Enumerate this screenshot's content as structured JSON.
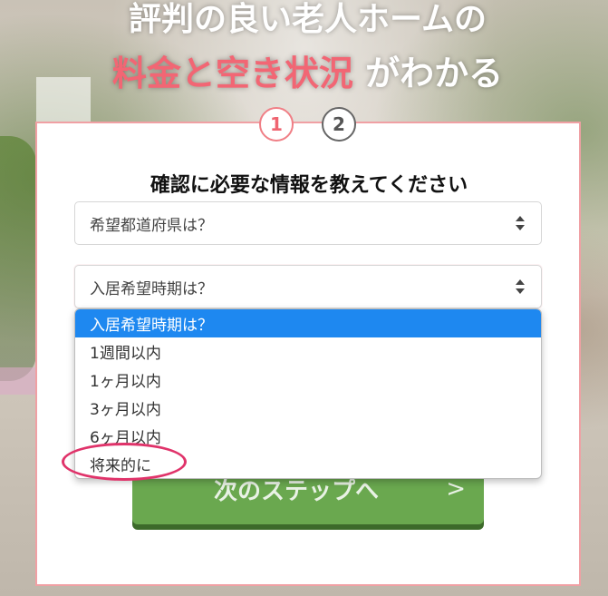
{
  "headline": {
    "line1": "評判の良い老人ホームの",
    "line2_highlight": "料金と空き状況",
    "line2_rest": " がわかる"
  },
  "steps": [
    "1",
    "2"
  ],
  "form": {
    "title": "確認に必要な情報を教えてください",
    "prefecture_select": "希望都道府県は？",
    "move_in_select": "入居希望時期は？",
    "next_button": "次のステップへ",
    "next_chevron": ">"
  },
  "dropdown": {
    "options": [
      "入居希望時期は？",
      "1週間以内",
      "1ヶ月以内",
      "3ヶ月以内",
      "6ヶ月以内",
      "将来的に"
    ],
    "selected": "入居希望時期は？"
  },
  "colors": {
    "accent_pink": "#f26674",
    "selected_blue": "#1e88f0",
    "button_green": "#6aa84f",
    "highlight_ring": "#e0336a"
  }
}
